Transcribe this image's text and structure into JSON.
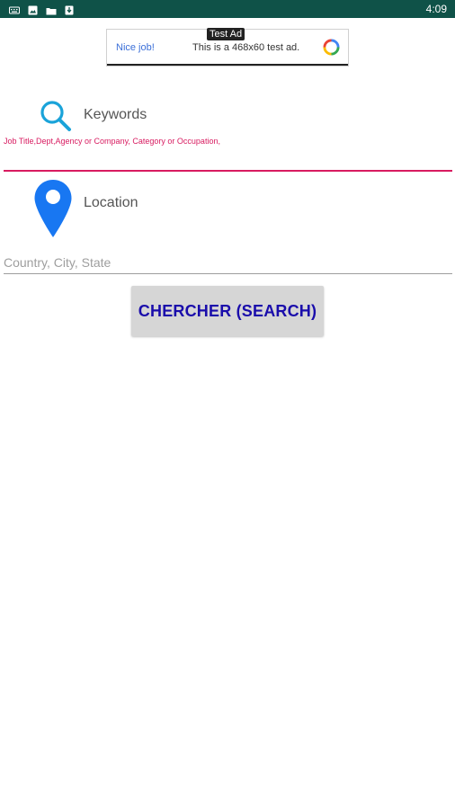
{
  "status_bar": {
    "time": "4:09",
    "icons": [
      "keyboard-icon",
      "image-icon",
      "folder-icon",
      "download-icon"
    ],
    "background": "#0f5248"
  },
  "ad": {
    "label": "Test Ad",
    "headline": "Nice job!",
    "body": "This is a 468x60 test ad."
  },
  "keywords": {
    "title": "Keywords",
    "hint": "Job Title,Dept,Agency or Company, Category or Occupation,",
    "value": "",
    "accent_color": "#d81b60"
  },
  "location": {
    "title": "Location",
    "placeholder": "Country, City, State",
    "value": "",
    "icon_color": "#1877f2"
  },
  "search_button": {
    "label": "CHERCHER (SEARCH)",
    "text_color": "#1a0dab"
  }
}
